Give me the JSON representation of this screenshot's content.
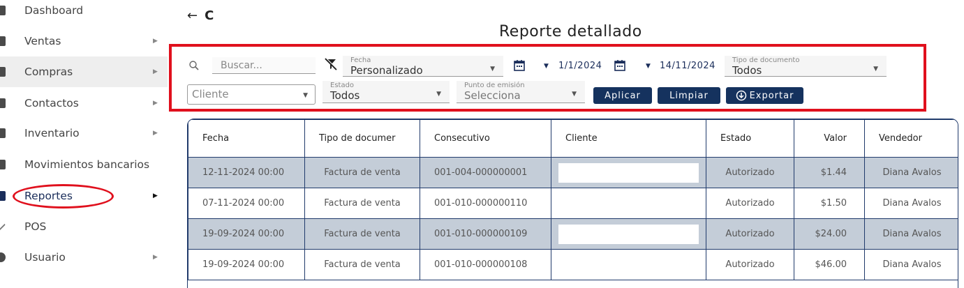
{
  "sidebar": {
    "items": [
      {
        "label": "Dashboard",
        "chevron": false
      },
      {
        "label": "Ventas",
        "chevron": true
      },
      {
        "label": "Compras",
        "chevron": true
      },
      {
        "label": "Contactos",
        "chevron": true
      },
      {
        "label": "Inventario",
        "chevron": true
      },
      {
        "label": "Movimientos bancarios",
        "chevron": false
      },
      {
        "label": "Reportes",
        "chevron": true
      },
      {
        "label": "POS",
        "chevron": false
      },
      {
        "label": "Usuario",
        "chevron": true
      }
    ],
    "active": "Reportes",
    "chevron_glyph": "▶"
  },
  "nav": {
    "back_icon": "arrow-left-icon",
    "back_glyph": "←",
    "refresh_icon": "refresh-icon",
    "refresh_glyph": "C"
  },
  "page": {
    "title": "Reporte detallado"
  },
  "filters": {
    "search_placeholder": "Buscar...",
    "fecha_label": "Fecha",
    "fecha_value": "Personalizado",
    "start_date": "1/1/2024",
    "end_date": "14/11/2024",
    "tipo_label": "Tipo de documento",
    "tipo_value": "Todos",
    "cliente_placeholder": "Cliente",
    "estado_label": "Estado",
    "estado_value": "Todos",
    "punto_label": "Punto de emisión",
    "punto_value": "Selecciona",
    "caret_glyph": "▼"
  },
  "buttons": {
    "apply": "Aplicar",
    "clear": "Limpiar",
    "export": "Exportar"
  },
  "table": {
    "headers": [
      "Fecha",
      "Tipo de documer",
      "Consecutivo",
      "Cliente",
      "Estado",
      "Valor",
      "Vendedor"
    ],
    "rows": [
      [
        "12-11-2024 00:00",
        "Factura de venta",
        "001-004-000000001",
        "",
        "Autorizado",
        "$1.44",
        "Diana Avalos"
      ],
      [
        "07-11-2024 00:00",
        "Factura de venta",
        "001-010-000000110",
        "",
        "Autorizado",
        "$1.50",
        "Diana Avalos"
      ],
      [
        "19-09-2024 00:00",
        "Factura de venta",
        "001-010-000000109",
        "",
        "Autorizado",
        "$24.00",
        "Diana Avalos"
      ],
      [
        "19-09-2024 00:00",
        "Factura de venta",
        "001-010-000000108",
        "",
        "Autorizado",
        "$46.00",
        "Diana Avalos"
      ]
    ]
  },
  "colors": {
    "primary": "#15325e",
    "highlight": "#e0101d",
    "row_shade": "#c4cdd8"
  }
}
